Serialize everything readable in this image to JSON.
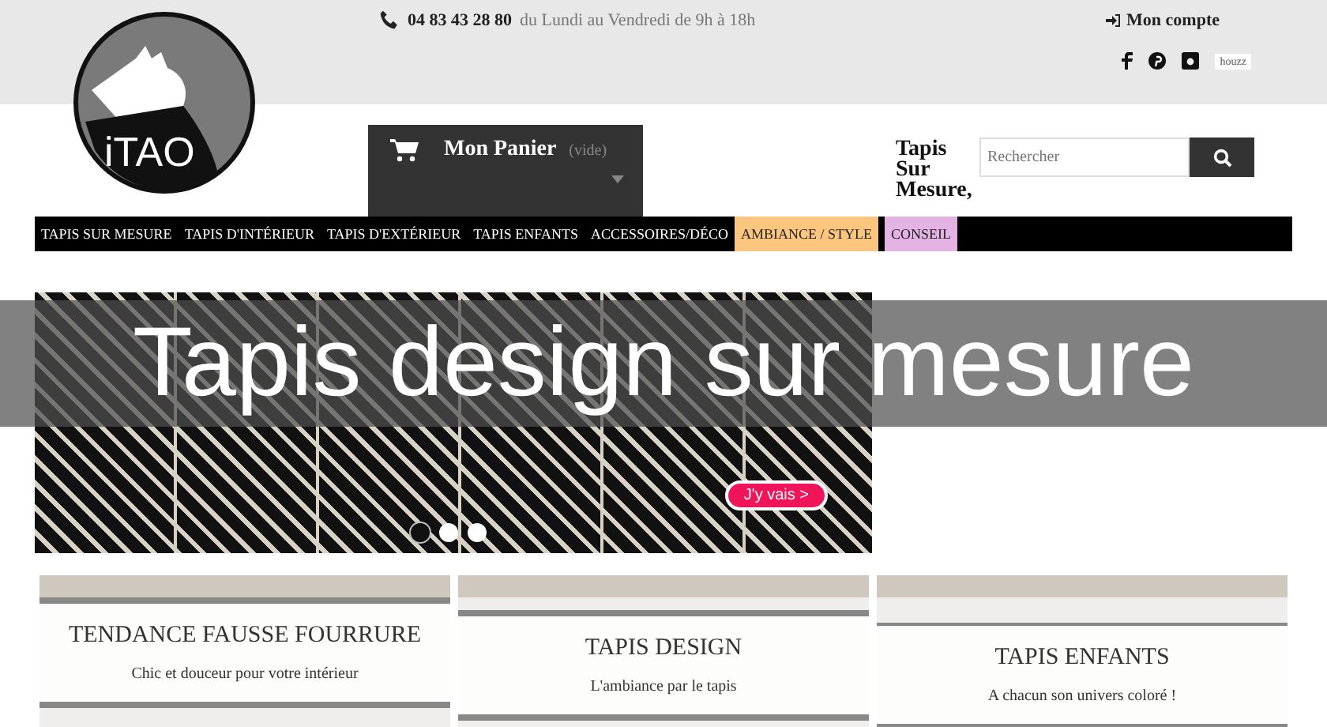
{
  "topbar": {
    "phone": "04 83 43 28 80",
    "hours": "du Lundi au Vendredi de 9h à 18h",
    "account": "Mon compte",
    "badge": "houzz"
  },
  "logo": {
    "text": "iTAO"
  },
  "cart": {
    "label": "Mon Panier",
    "status": "(vide)"
  },
  "tagline": "Tapis Sur Mesure,",
  "search": {
    "placeholder": "Rechercher"
  },
  "nav": [
    {
      "label": "TAPIS SUR MESURE"
    },
    {
      "label": "TAPIS D'INTÉRIEUR"
    },
    {
      "label": "TAPIS D'EXTÉRIEUR"
    },
    {
      "label": "TAPIS ENFANTS"
    },
    {
      "label": "ACCESSOIRES/DÉCO"
    },
    {
      "label": "AMBIANCE / STYLE",
      "color": "#fdc67f"
    },
    {
      "label": "CONSEIL",
      "color": "#e3b3e3"
    }
  ],
  "banner": {
    "button": "J'y vais >",
    "dots": [
      {
        "selected": true
      },
      {
        "selected": false
      },
      {
        "selected": false
      }
    ]
  },
  "overlay_title": "Tapis design sur mesure",
  "cards": [
    {
      "title": "TENDANCE FAUSSE FOURRURE",
      "subtitle": "Chic et douceur pour votre intérieur"
    },
    {
      "title": "TAPIS DESIGN",
      "subtitle": "L'ambiance par le tapis"
    },
    {
      "title": "TAPIS ENFANTS",
      "subtitle": "A chacun son univers coloré !"
    }
  ]
}
